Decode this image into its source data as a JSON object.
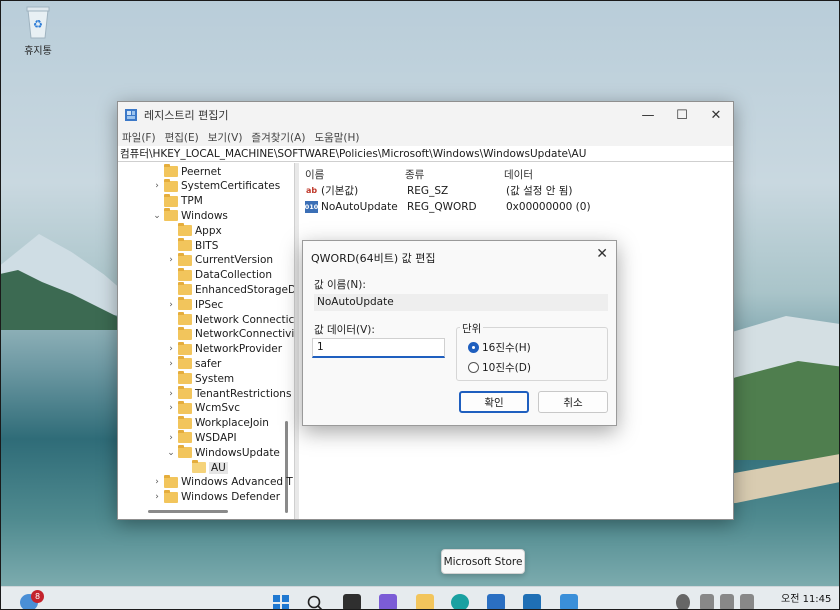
{
  "desktop": {
    "recycle_bin_label": "휴지통",
    "store_tooltip": "Microsoft Store"
  },
  "regedit": {
    "title": "레지스트리 편집기",
    "menu": [
      "파일(F)",
      "편집(E)",
      "보기(V)",
      "즐겨찾기(A)",
      "도움말(H)"
    ],
    "address": "컴퓨터\\HKEY_LOCAL_MACHINE\\SOFTWARE\\Policies\\Microsoft\\Windows\\WindowsUpdate\\AU",
    "tree": [
      {
        "label": "Peernet",
        "arrow": ""
      },
      {
        "label": "SystemCertificates",
        "arrow": "›"
      },
      {
        "label": "TPM",
        "arrow": ""
      },
      {
        "label": "Windows",
        "arrow": "⌄"
      },
      {
        "label": "Appx",
        "arrow": ""
      },
      {
        "label": "BITS",
        "arrow": ""
      },
      {
        "label": "CurrentVersion",
        "arrow": "›"
      },
      {
        "label": "DataCollection",
        "arrow": ""
      },
      {
        "label": "EnhancedStorageD",
        "arrow": ""
      },
      {
        "label": "IPSec",
        "arrow": "›"
      },
      {
        "label": "Network Connectic",
        "arrow": ""
      },
      {
        "label": "NetworkConnectivi",
        "arrow": ""
      },
      {
        "label": "NetworkProvider",
        "arrow": "›"
      },
      {
        "label": "safer",
        "arrow": "›"
      },
      {
        "label": "System",
        "arrow": ""
      },
      {
        "label": "TenantRestrictions",
        "arrow": "›"
      },
      {
        "label": "WcmSvc",
        "arrow": "›"
      },
      {
        "label": "WorkplaceJoin",
        "arrow": ""
      },
      {
        "label": "WSDAPI",
        "arrow": "›"
      },
      {
        "label": "WindowsUpdate",
        "arrow": "⌄"
      },
      {
        "label": "AU",
        "arrow": ""
      },
      {
        "label": "Windows Advanced T",
        "arrow": "›"
      },
      {
        "label": "Windows Defender",
        "arrow": "›"
      }
    ],
    "columns": {
      "name": "이름",
      "type": "종류",
      "data": "데이터"
    },
    "values": [
      {
        "icon": "ab",
        "name": "(기본값)",
        "type": "REG_SZ",
        "data": "(값 설정 안 됨)"
      },
      {
        "icon": "010",
        "name": "NoAutoUpdate",
        "type": "REG_QWORD",
        "data": "0x00000000 (0)"
      }
    ]
  },
  "dialog": {
    "title": "QWORD(64비트) 값 편집",
    "name_label": "값 이름(N):",
    "name_value": "NoAutoUpdate",
    "data_label": "값 데이터(V):",
    "data_value": "1",
    "base_group_label": "단위",
    "radio_hex": "16진수(H)",
    "radio_dec": "10진수(D)",
    "selected_base": "hex",
    "ok": "확인",
    "cancel": "취소"
  },
  "taskbar": {
    "notification_count": "8",
    "clock_time": "오전 11:45"
  }
}
